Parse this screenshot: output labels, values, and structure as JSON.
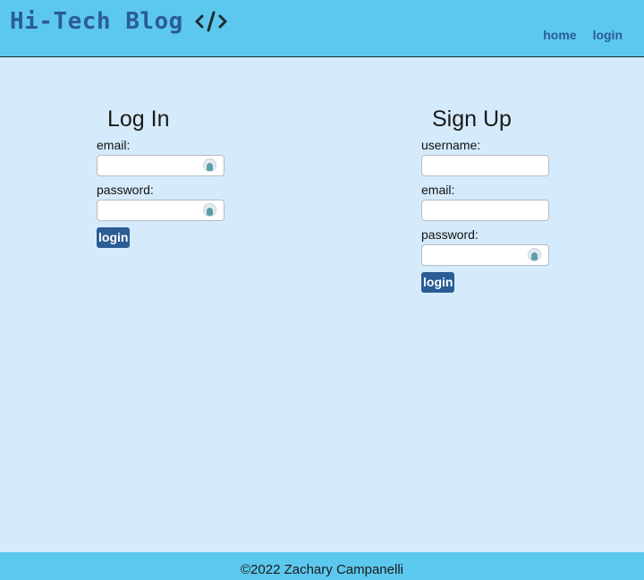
{
  "header": {
    "brand_title": "Hi-Tech Blog",
    "brand_icon": "code-icon",
    "nav": {
      "home_label": "home",
      "login_label": "login"
    }
  },
  "login": {
    "title": "Log In",
    "email_label": "email:",
    "email_value": "",
    "password_label": "password:",
    "password_value": "",
    "submit_label": "login"
  },
  "signup": {
    "title": "Sign Up",
    "username_label": "username:",
    "username_value": "",
    "email_label": "email:",
    "email_value": "",
    "password_label": "password:",
    "password_value": "",
    "submit_label": "login"
  },
  "footer": {
    "text": "©2022 Zachary Campanelli"
  },
  "colors": {
    "header_bg": "#5cc8ed",
    "page_bg": "#d5ebfb",
    "brand": "#2a5c95",
    "button_bg": "#2a5c95"
  }
}
